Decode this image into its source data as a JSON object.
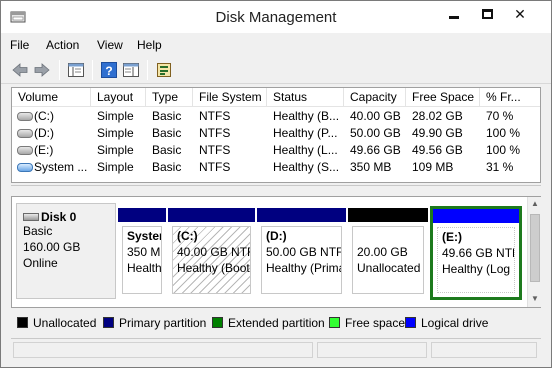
{
  "window": {
    "title": "Disk Management"
  },
  "titlebar_buttons": {
    "minimize": "minimize",
    "maximize": "maximize",
    "close": "✕"
  },
  "menu": [
    "File",
    "Action",
    "View",
    "Help"
  ],
  "toolbar": {
    "icons": [
      "back-icon",
      "forward-icon",
      "console-tree-icon",
      "help-icon",
      "action-pane-icon",
      "properties-icon"
    ]
  },
  "volumes": {
    "columns": [
      "Volume",
      "Layout",
      "Type",
      "File System",
      "Status",
      "Capacity",
      "Free Space",
      "% Fr..."
    ],
    "rows": [
      {
        "volume": "(C:)",
        "layout": "Simple",
        "type": "Basic",
        "fs": "NTFS",
        "status": "Healthy (B...",
        "capacity": "40.00 GB",
        "free": "28.02 GB",
        "pct": "70 %",
        "icon": "drive-icon"
      },
      {
        "volume": "(D:)",
        "layout": "Simple",
        "type": "Basic",
        "fs": "NTFS",
        "status": "Healthy (P...",
        "capacity": "50.00 GB",
        "free": "49.90 GB",
        "pct": "100 %",
        "icon": "drive-icon"
      },
      {
        "volume": "(E:)",
        "layout": "Simple",
        "type": "Basic",
        "fs": "NTFS",
        "status": "Healthy (L...",
        "capacity": "49.66 GB",
        "free": "49.56 GB",
        "pct": "100 %",
        "icon": "drive-icon"
      },
      {
        "volume": "System ...",
        "layout": "Simple",
        "type": "Basic",
        "fs": "NTFS",
        "status": "Healthy (S...",
        "capacity": "350 MB",
        "free": "109 MB",
        "pct": "31 %",
        "icon": "system-drive-icon"
      }
    ]
  },
  "disk": {
    "name": "Disk 0",
    "type": "Basic",
    "size": "160.00 GB",
    "state": "Online",
    "partitions": [
      {
        "name": "Syster",
        "size": "350 M",
        "status": "Health",
        "bar_color": "#000080",
        "hatched": false,
        "selected": false
      },
      {
        "name": "(C:)",
        "size": "40.00 GB NTFS",
        "status": "Healthy (Boot",
        "bar_color": "#000080",
        "hatched": true,
        "selected": false
      },
      {
        "name": "(D:)",
        "size": "50.00 GB NTFS",
        "status": "Healthy (Prima",
        "bar_color": "#000080",
        "hatched": false,
        "selected": false
      },
      {
        "name": "",
        "size": "20.00 GB",
        "status": "Unallocated",
        "bar_color": "#000000",
        "hatched": false,
        "selected": false
      },
      {
        "name": "(E:)",
        "size": "49.66 GB NTF",
        "status": "Healthy (Log",
        "bar_color": "#0000ff",
        "hatched": false,
        "selected": true
      }
    ]
  },
  "legend": [
    {
      "label": "Unallocated",
      "color": "#000000"
    },
    {
      "label": "Primary partition",
      "color": "#000080"
    },
    {
      "label": "Extended partition",
      "color": "#008000"
    },
    {
      "label": "Free space",
      "color": "#33ff33"
    },
    {
      "label": "Logical drive",
      "color": "#0000ff"
    }
  ],
  "colors": {
    "selected_border": "#1d7a1d",
    "window_bg": "#f0f0f0"
  }
}
